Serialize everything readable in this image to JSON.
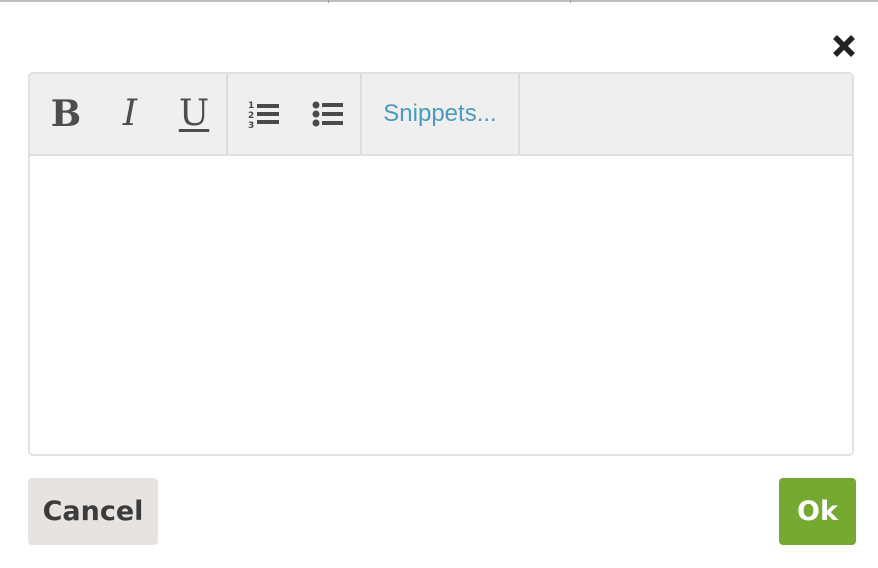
{
  "dialog": {
    "close_icon": "close-icon"
  },
  "toolbar": {
    "bold_label": "B",
    "italic_label": "I",
    "underline_label": "U",
    "ordered_list_icon": "ordered-list-icon",
    "unordered_list_icon": "unordered-list-icon",
    "snippets_label": "Snippets..."
  },
  "editor": {
    "value": "",
    "placeholder": ""
  },
  "footer": {
    "cancel_label": "Cancel",
    "ok_label": "Ok"
  },
  "colors": {
    "ok_green": "#76a932",
    "snippets_blue": "#4a9bbd",
    "cancel_gray": "#e6e3e1",
    "toolbar_gray": "#efefef"
  }
}
